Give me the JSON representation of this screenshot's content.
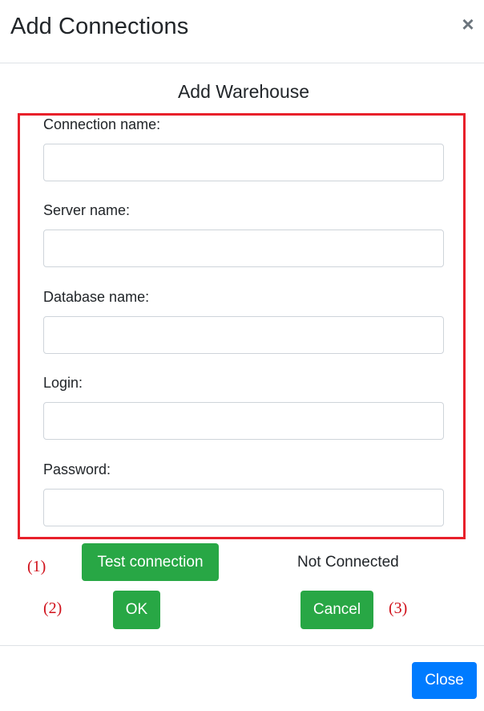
{
  "modal": {
    "title": "Add Connections",
    "close_symbol": "×"
  },
  "form": {
    "title": "Add Warehouse",
    "fields": [
      {
        "label": "Connection name:",
        "value": "",
        "placeholder": ""
      },
      {
        "label": "Server name:",
        "value": "",
        "placeholder": ""
      },
      {
        "label": "Database name:",
        "value": "",
        "placeholder": ""
      },
      {
        "label": "Login:",
        "value": "",
        "placeholder": ""
      },
      {
        "label": "Password:",
        "value": "",
        "placeholder": ""
      }
    ]
  },
  "actions": {
    "test_connection_label": "Test connection",
    "status_text": "Not Connected",
    "ok_label": "OK",
    "cancel_label": "Cancel"
  },
  "annotations": {
    "marker_1": "(1)",
    "marker_2": "(2)",
    "marker_3": "(3)"
  },
  "footer": {
    "close_label": "Close"
  },
  "colors": {
    "highlight_border": "#e8202a",
    "annotation_text": "#d0101a",
    "success_button": "#28a745",
    "primary_button": "#007bff"
  }
}
